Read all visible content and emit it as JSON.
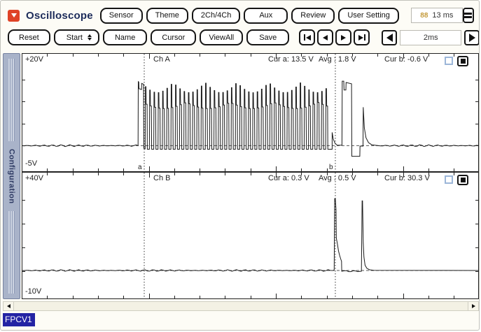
{
  "window": {
    "title": "Oscilloscope",
    "accent_red": "#df4327",
    "title_color": "#1c2b5a"
  },
  "toolbar": {
    "menu_buttons": [
      "Sensor",
      "Theme",
      "2Ch/4Ch",
      "Aux",
      "Review",
      "User Setting"
    ],
    "time_display": {
      "icon_glyph": "88",
      "value": "13 ms"
    },
    "row2_buttons": [
      "Reset",
      "Start",
      "Name",
      "Cursor",
      "ViewAll",
      "Save"
    ],
    "timebase": {
      "value": "2ms"
    }
  },
  "sidebar": {
    "label": "Configuration"
  },
  "status": {
    "label": "FPCV1"
  },
  "chart_data": [
    {
      "type": "line",
      "name": "Ch A",
      "y_top_label": "+20V",
      "y_bottom_label": "-5V",
      "y_range": [
        -5,
        20
      ],
      "tick_v": 5,
      "baseline_v": 0,
      "noise_v": 0.13,
      "readouts": {
        "cur_a": "Cur a: 13.5 V",
        "avg": "Avg : 1.8 V",
        "cur_b": "Cur b: -0.6 V"
      },
      "cursors": {
        "a": 0.268,
        "b": 0.686,
        "a_label": "a",
        "b_label": "b",
        "show_labels": true
      },
      "waveform": {
        "pre": [
          [
            0,
            0
          ],
          [
            0.2545,
            0
          ],
          [
            0.255,
            14.5
          ],
          [
            0.256,
            14.4
          ],
          [
            0.2565,
            12.9
          ],
          [
            0.262,
            12.7
          ],
          [
            0.2625,
            14.1
          ],
          [
            0.2665,
            13.9
          ],
          [
            0.267,
            -0.6
          ],
          [
            0.2695,
            -0.6
          ]
        ],
        "burst": {
          "from": 0.27,
          "to": 0.679,
          "period": 0.0094,
          "high": 14.3,
          "high_jitter": 2.3,
          "mid": 9.8,
          "mid_jitter": 1.4,
          "low": -0.8
        },
        "post": [
          [
            0.679,
            3.0
          ],
          [
            0.6815,
            1.5
          ],
          [
            0.685,
            0.6
          ],
          [
            0.69,
            0.1
          ],
          [
            0.7005,
            0.1
          ],
          [
            0.701,
            14.6
          ],
          [
            0.7045,
            14.6
          ],
          [
            0.705,
            12.6
          ],
          [
            0.709,
            12.6
          ],
          [
            0.7095,
            14.3
          ],
          [
            0.7215,
            14.0
          ],
          [
            0.722,
            -2.4
          ],
          [
            0.7395,
            -2.4
          ],
          [
            0.74,
            -0.1
          ],
          [
            0.7465,
            -0.1
          ],
          [
            0.747,
            8.7
          ],
          [
            0.7495,
            4.0
          ],
          [
            0.753,
            1.8
          ],
          [
            0.7585,
            0.7
          ],
          [
            0.7655,
            0.2
          ],
          [
            0.78,
            0
          ],
          [
            1,
            0
          ]
        ]
      }
    },
    {
      "type": "line",
      "name": "Ch B",
      "y_top_label": "+40V",
      "y_bottom_label": "-10V",
      "y_range": [
        -10,
        40
      ],
      "tick_v": 10,
      "baseline_v": 0.3,
      "noise_v": 0.22,
      "readouts": {
        "cur_a": "Cur a: 0.3 V",
        "avg": "Avg : 0.5 V",
        "cur_b": "Cur b: 30.3 V"
      },
      "cursors": {
        "a": 0.268,
        "b": 0.686,
        "a_label": "a",
        "b_label": "b",
        "show_labels": false
      },
      "waveform": {
        "points": [
          [
            0,
            0.3
          ],
          [
            0.6815,
            0.3
          ],
          [
            0.6835,
            0.6
          ],
          [
            0.6845,
            30.5
          ],
          [
            0.686,
            30.5
          ],
          [
            0.6875,
            26
          ],
          [
            0.688,
            14
          ],
          [
            0.6905,
            11.5
          ],
          [
            0.693,
            8.5
          ],
          [
            0.6955,
            6.5
          ],
          [
            0.698,
            5
          ],
          [
            0.6995,
            4.2
          ],
          [
            0.7,
            0
          ],
          [
            0.743,
            0
          ],
          [
            0.7445,
            29.6
          ],
          [
            0.7455,
            29.6
          ],
          [
            0.747,
            12
          ],
          [
            0.7485,
            6
          ],
          [
            0.751,
            2.5
          ],
          [
            0.755,
            1.2
          ],
          [
            0.761,
            0.6
          ],
          [
            0.77,
            0.35
          ],
          [
            1,
            0.3
          ]
        ]
      }
    }
  ]
}
